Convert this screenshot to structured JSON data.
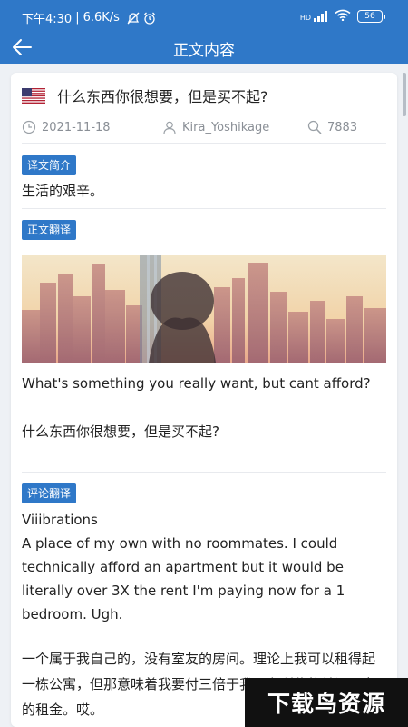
{
  "status_bar": {
    "time": "下午4:30",
    "speed": "6.6K/s",
    "network": "HD",
    "battery": "56"
  },
  "app_bar": {
    "title": "正文内容",
    "back_icon": "back-arrow-icon"
  },
  "post": {
    "flag_icon": "us-flag-icon",
    "title": "什么东西你很想要，但是买不起?",
    "date": "2021-11-18",
    "author": "Kira_Yoshikage",
    "views": "7883"
  },
  "sections": {
    "summary_tag": "译文简介",
    "summary_text": "生活的艰辛。",
    "translation_tag": "正文翻译",
    "original_text": "What's something you really want, but cant afford?",
    "translated_text": "什么东西你很想要，但是买不起?",
    "comment_tag": "评论翻译"
  },
  "comment": {
    "username": "Viiibrations",
    "original_text": "A place of my own with no roommates. I could technically afford an apartment but it would be literally over 3X the rent I'm paying now for a 1 bedroom. Ugh.",
    "translated_text": "一个属于我自己的，没有室友的房间。理论上我可以租得起一栋公寓，但那意味着我要付三倍于我现在所住的单间公寓的租金。哎。"
  },
  "watermark": "下载鸟资源",
  "colors": {
    "primary": "#2f78c8",
    "background": "#eef1f5",
    "meta": "#8a8f96"
  }
}
